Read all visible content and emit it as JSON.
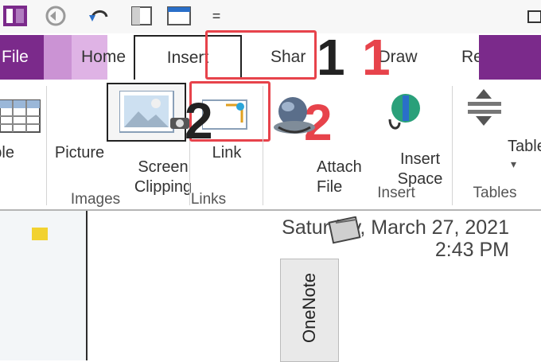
{
  "quick_access": {
    "customize_label": "="
  },
  "tabs": [
    {
      "label": "File"
    },
    {
      "label": "Home"
    },
    {
      "label": "Insert"
    },
    {
      "label": "Shar"
    },
    {
      "label": "Draw"
    },
    {
      "label": "Re"
    }
  ],
  "ribbon": {
    "table_label": "Table",
    "picture_label": "Picture",
    "screen_clipping_label": "Screen\nClipping",
    "link_label": "Link",
    "attach_file_label": "Attach\nFile",
    "insert_space_label": "Insert\nSpace",
    "tables_right_label": "Table",
    "groups": {
      "images": "Images",
      "links": "Links",
      "insert": "Insert",
      "tables": "Tables"
    }
  },
  "annotations": {
    "step1": "1",
    "step2": "2"
  },
  "page": {
    "date": "Saturday, March 27, 2021",
    "time": "2:43 PM",
    "onenote_tab": "OneNote"
  },
  "colors": {
    "brand_purple": "#7b2a8b",
    "annotation_red": "#e7434b"
  }
}
